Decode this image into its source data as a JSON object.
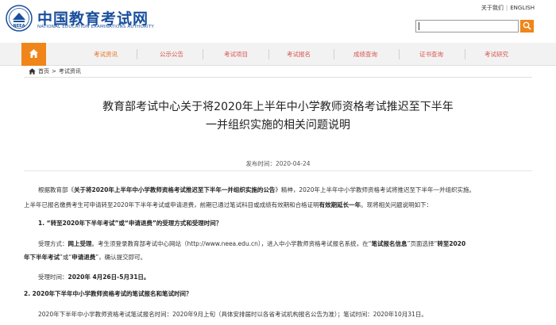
{
  "header": {
    "logo_cn": "中国教育考试网",
    "logo_en": "NATIONAL EDUCATION EXAMINATIONS AUTHORITY",
    "links": [
      "关于我们",
      "ENGLISH"
    ],
    "search": {
      "value": "",
      "placeholder": ""
    }
  },
  "nav": {
    "items": [
      "考试资讯",
      "公示公告",
      "考试项目",
      "考试报名",
      "成绩查询",
      "证书查询",
      "考试研究"
    ],
    "active": "考试资讯",
    "accent": "#f08519"
  },
  "breadcrumb": [
    "首页",
    "考试资讯"
  ],
  "article": {
    "title_line1": "教育部考试中心关于将2020年上半年中小学教师资格考试推迟至下半年",
    "title_line2": "一并组织实施的相关问题说明",
    "pub_label": "发布时间：",
    "pub_date": "2020-04-24",
    "p1_a": "根据教育部《",
    "p1_b": "关于将2020年上半年中小学教师资格考试推迟至下半年一并组织实施的公告",
    "p1_c": "》精神，2020年上半年中小学教师资格考试将推迟至下半年一并组织实施。",
    "p2_a": "上半年已报名缴费考生可申请转至2020年下半年考试或申请退费，前期已通过笔试科目或成绩有效期和合格证明",
    "p2_b": "有效期延长一年",
    "p2_c": "。现将相关问题说明如下：",
    "s1_heading": "1. “转至2020年下半年考试”或“申请退费”的受理方式和受理时间？",
    "s1_a": "受理方式：",
    "s1_b": "网上受理",
    "s1_c": "。考生须登录教育部考试中心网站（http://www.neea.edu.cn），进入中小学教师资格考试报名系统，在“",
    "s1_d": "笔试报名信息",
    "s1_e": "”页面选择“",
    "s1_f": "转至2020",
    "s1_g": "年下半年考试",
    "s1_h": "”或“",
    "s1_i": "申请退费",
    "s1_j": "”，确认提交即可。",
    "s1_time_label": "受理时间：",
    "s1_time": "2020年 4月26日-5月31日。",
    "s2_heading": "2. 2020年下半年中小学教师资格考试的笔试报名和笔试时间？",
    "s2_text": "2020年下半年中小学教师资格考试笔试报名时间：2020年9月上旬（具体安排届时以各省考试机构报名公告为准）；笔试时间：2020年10月31日。"
  }
}
